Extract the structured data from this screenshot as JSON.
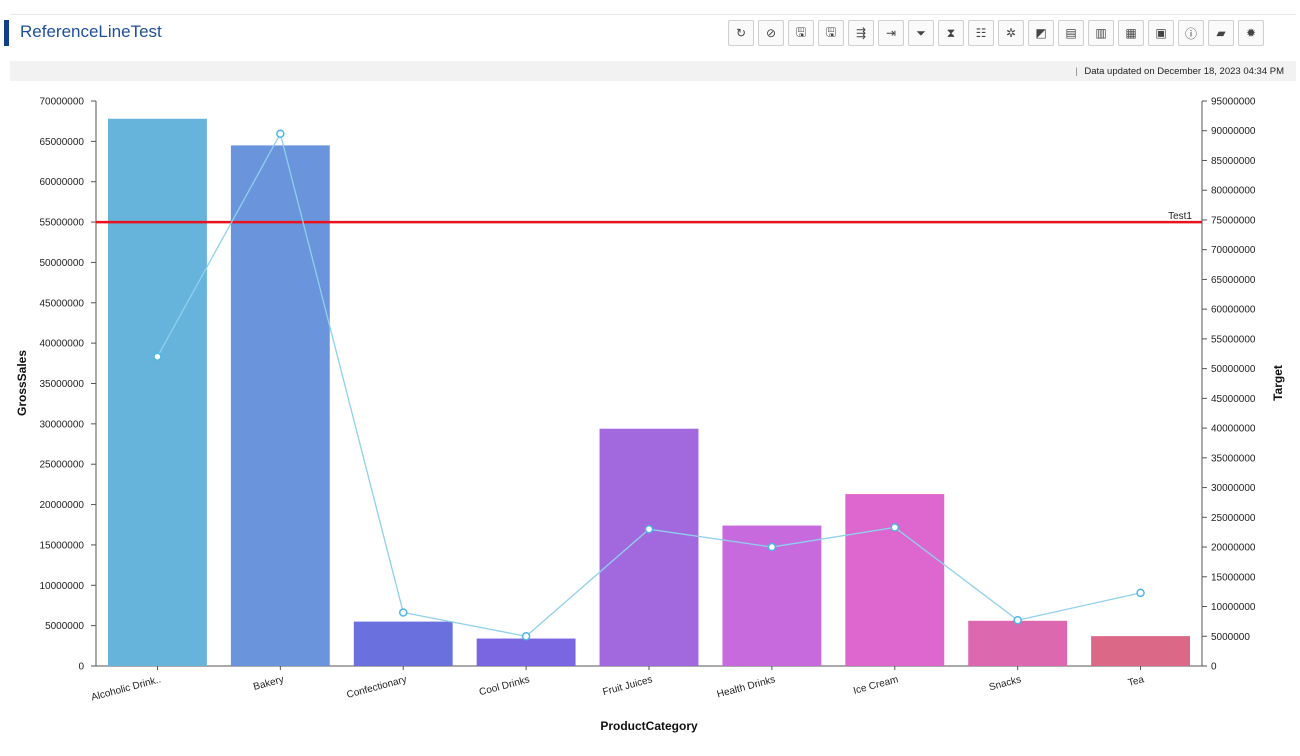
{
  "header": {
    "title": "ReferenceLineTest",
    "toolbar": [
      {
        "name": "refresh-icon",
        "glyph": "↻"
      },
      {
        "name": "reset-icon",
        "glyph": "⊘"
      },
      {
        "name": "save-icon",
        "glyph": "🖫"
      },
      {
        "name": "save-as-icon",
        "glyph": "🖫"
      },
      {
        "name": "export-icon",
        "glyph": "⇶"
      },
      {
        "name": "exit-icon",
        "glyph": "⇥"
      },
      {
        "name": "filter-icon",
        "glyph": "⏷"
      },
      {
        "name": "hourglass-icon",
        "glyph": "⧗"
      },
      {
        "name": "hierarchy-icon",
        "glyph": "☷"
      },
      {
        "name": "magic-wand-icon",
        "glyph": "✲"
      },
      {
        "name": "layers-icon",
        "glyph": "◩"
      },
      {
        "name": "table-icon",
        "glyph": "▤"
      },
      {
        "name": "bar-chart-icon",
        "glyph": "▥"
      },
      {
        "name": "grid-icon",
        "glyph": "▦"
      },
      {
        "name": "image-icon",
        "glyph": "▣"
      },
      {
        "name": "info-icon",
        "glyph": "ⓘ"
      },
      {
        "name": "comment-icon",
        "glyph": "▰"
      },
      {
        "name": "settings-icon",
        "glyph": "✹"
      }
    ]
  },
  "status": {
    "separator": "|",
    "label": "Data updated on",
    "timestamp": "December 18, 2023 04:34 PM"
  },
  "chart_data": {
    "type": "bar",
    "xlabel": "ProductCategory",
    "ylabel": "GrossSales",
    "y2label": "Target",
    "ylim": [
      0,
      70000000
    ],
    "y2lim": [
      0,
      95000000
    ],
    "y_ticks": [
      "0",
      "5000000",
      "10000000",
      "15000000",
      "20000000",
      "25000000",
      "30000000",
      "35000000",
      "40000000",
      "45000000",
      "50000000",
      "55000000",
      "60000000",
      "65000000",
      "70000000"
    ],
    "y2_ticks": [
      "0",
      "5000000",
      "10000000",
      "15000000",
      "20000000",
      "25000000",
      "30000000",
      "35000000",
      "40000000",
      "45000000",
      "50000000",
      "55000000",
      "60000000",
      "65000000",
      "70000000",
      "75000000",
      "80000000",
      "85000000",
      "90000000",
      "95000000"
    ],
    "categories": [
      "Alcoholic Drink..",
      "Bakery",
      "Confectionary",
      "Cool Drinks",
      "Fruit Juices",
      "Health Drinks",
      "Ice Cream",
      "Snacks",
      "Tea"
    ],
    "series": [
      {
        "name": "GrossSales",
        "kind": "bar",
        "axis": "left",
        "values": [
          67800000,
          64500000,
          5500000,
          3400000,
          29400000,
          17400000,
          21300000,
          5600000,
          3700000
        ],
        "colors": [
          "#66b4dc",
          "#6a94dc",
          "#6a70de",
          "#7a66e0",
          "#a269de",
          "#c66ade",
          "#de67cf",
          "#dc69b0",
          "#dc6888"
        ]
      },
      {
        "name": "Target",
        "kind": "line",
        "axis": "right",
        "color": "#8fd0ec",
        "values": [
          52000000,
          89500000,
          9000000,
          5000000,
          23000000,
          20000000,
          23300000,
          7700000,
          12300000
        ]
      }
    ],
    "reference_line": {
      "label": "Test1",
      "value": 55000000,
      "axis": "left",
      "color": "#e8131d"
    },
    "grid": false,
    "legend": "none"
  }
}
